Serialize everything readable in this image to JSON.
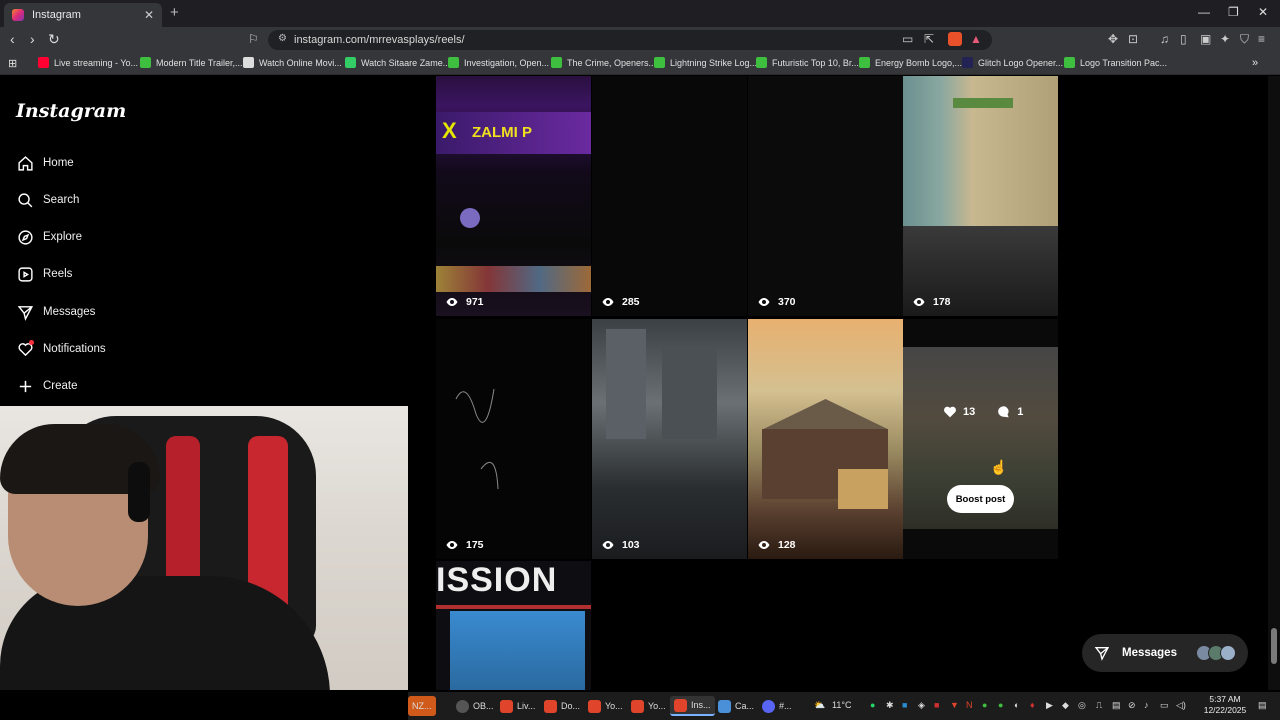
{
  "browser": {
    "tab_title": "Instagram",
    "url": "instagram.com/mrrevasplays/reels/",
    "bookmarks": [
      {
        "label": "Live streaming - Yo...",
        "color": "#ff0033"
      },
      {
        "label": "Modern Title Trailer,...",
        "color": "#3fbf3f"
      },
      {
        "label": "Watch Online Movi...",
        "color": "#dddddd"
      },
      {
        "label": "Watch Sitaare Zame...",
        "color": "#33cc66"
      },
      {
        "label": "Investigation, Open...",
        "color": "#3fbf3f"
      },
      {
        "label": "The Crime, Openers...",
        "color": "#3fbf3f"
      },
      {
        "label": "Lightning Strike Log...",
        "color": "#3fbf3f"
      },
      {
        "label": "Futuristic Top 10, Br...",
        "color": "#3fbf3f"
      },
      {
        "label": "Energy Bomb Logo,...",
        "color": "#3fbf3f"
      },
      {
        "label": "Glitch Logo Opener...",
        "color": "#222255"
      },
      {
        "label": "Logo Transition Pac...",
        "color": "#3fbf3f"
      }
    ]
  },
  "sidebar": {
    "logo": "Instagram",
    "items": [
      {
        "label": "Home",
        "icon": "home-icon"
      },
      {
        "label": "Search",
        "icon": "search-icon"
      },
      {
        "label": "Explore",
        "icon": "compass-icon"
      },
      {
        "label": "Reels",
        "icon": "reels-icon"
      },
      {
        "label": "Messages",
        "icon": "messenger-icon"
      },
      {
        "label": "Notifications",
        "icon": "heart-icon"
      },
      {
        "label": "Create",
        "icon": "plus-icon"
      }
    ]
  },
  "grid": {
    "tiles": [
      {
        "views": "971",
        "bg": "zalmi"
      },
      {
        "views": "285",
        "bg": "dark"
      },
      {
        "views": "370",
        "bg": "dark"
      },
      {
        "views": "178",
        "bg": "game-wall"
      },
      {
        "views": "175",
        "bg": "black-scribble"
      },
      {
        "views": "103",
        "bg": "city"
      },
      {
        "views": "128",
        "bg": "warehouse"
      },
      {
        "views": "",
        "bg": "game-hover"
      },
      {
        "views": "",
        "bg": "mission"
      }
    ],
    "hover": {
      "likes": "13",
      "comments": "1",
      "boost_label": "Boost post"
    },
    "mission_text": "ISSION"
  },
  "messages_pill": {
    "label": "Messages"
  },
  "taskbar": {
    "apps": [
      {
        "label": "NZ...",
        "color": "#d05a1a"
      },
      {
        "label": "OB...",
        "color": "#555555"
      },
      {
        "label": "Liv...",
        "color": "#e0452b"
      },
      {
        "label": "Do...",
        "color": "#e0452b"
      },
      {
        "label": "Yo...",
        "color": "#e0452b"
      },
      {
        "label": "Yo...",
        "color": "#e0452b"
      },
      {
        "label": "Ins...",
        "color": "#e0452b"
      },
      {
        "label": "Ca...",
        "color": "#4a90d9"
      },
      {
        "label": "#...",
        "color": "#5865f2"
      }
    ],
    "weather": "11°C",
    "time": "5:37 AM",
    "date": "12/22/2025"
  }
}
